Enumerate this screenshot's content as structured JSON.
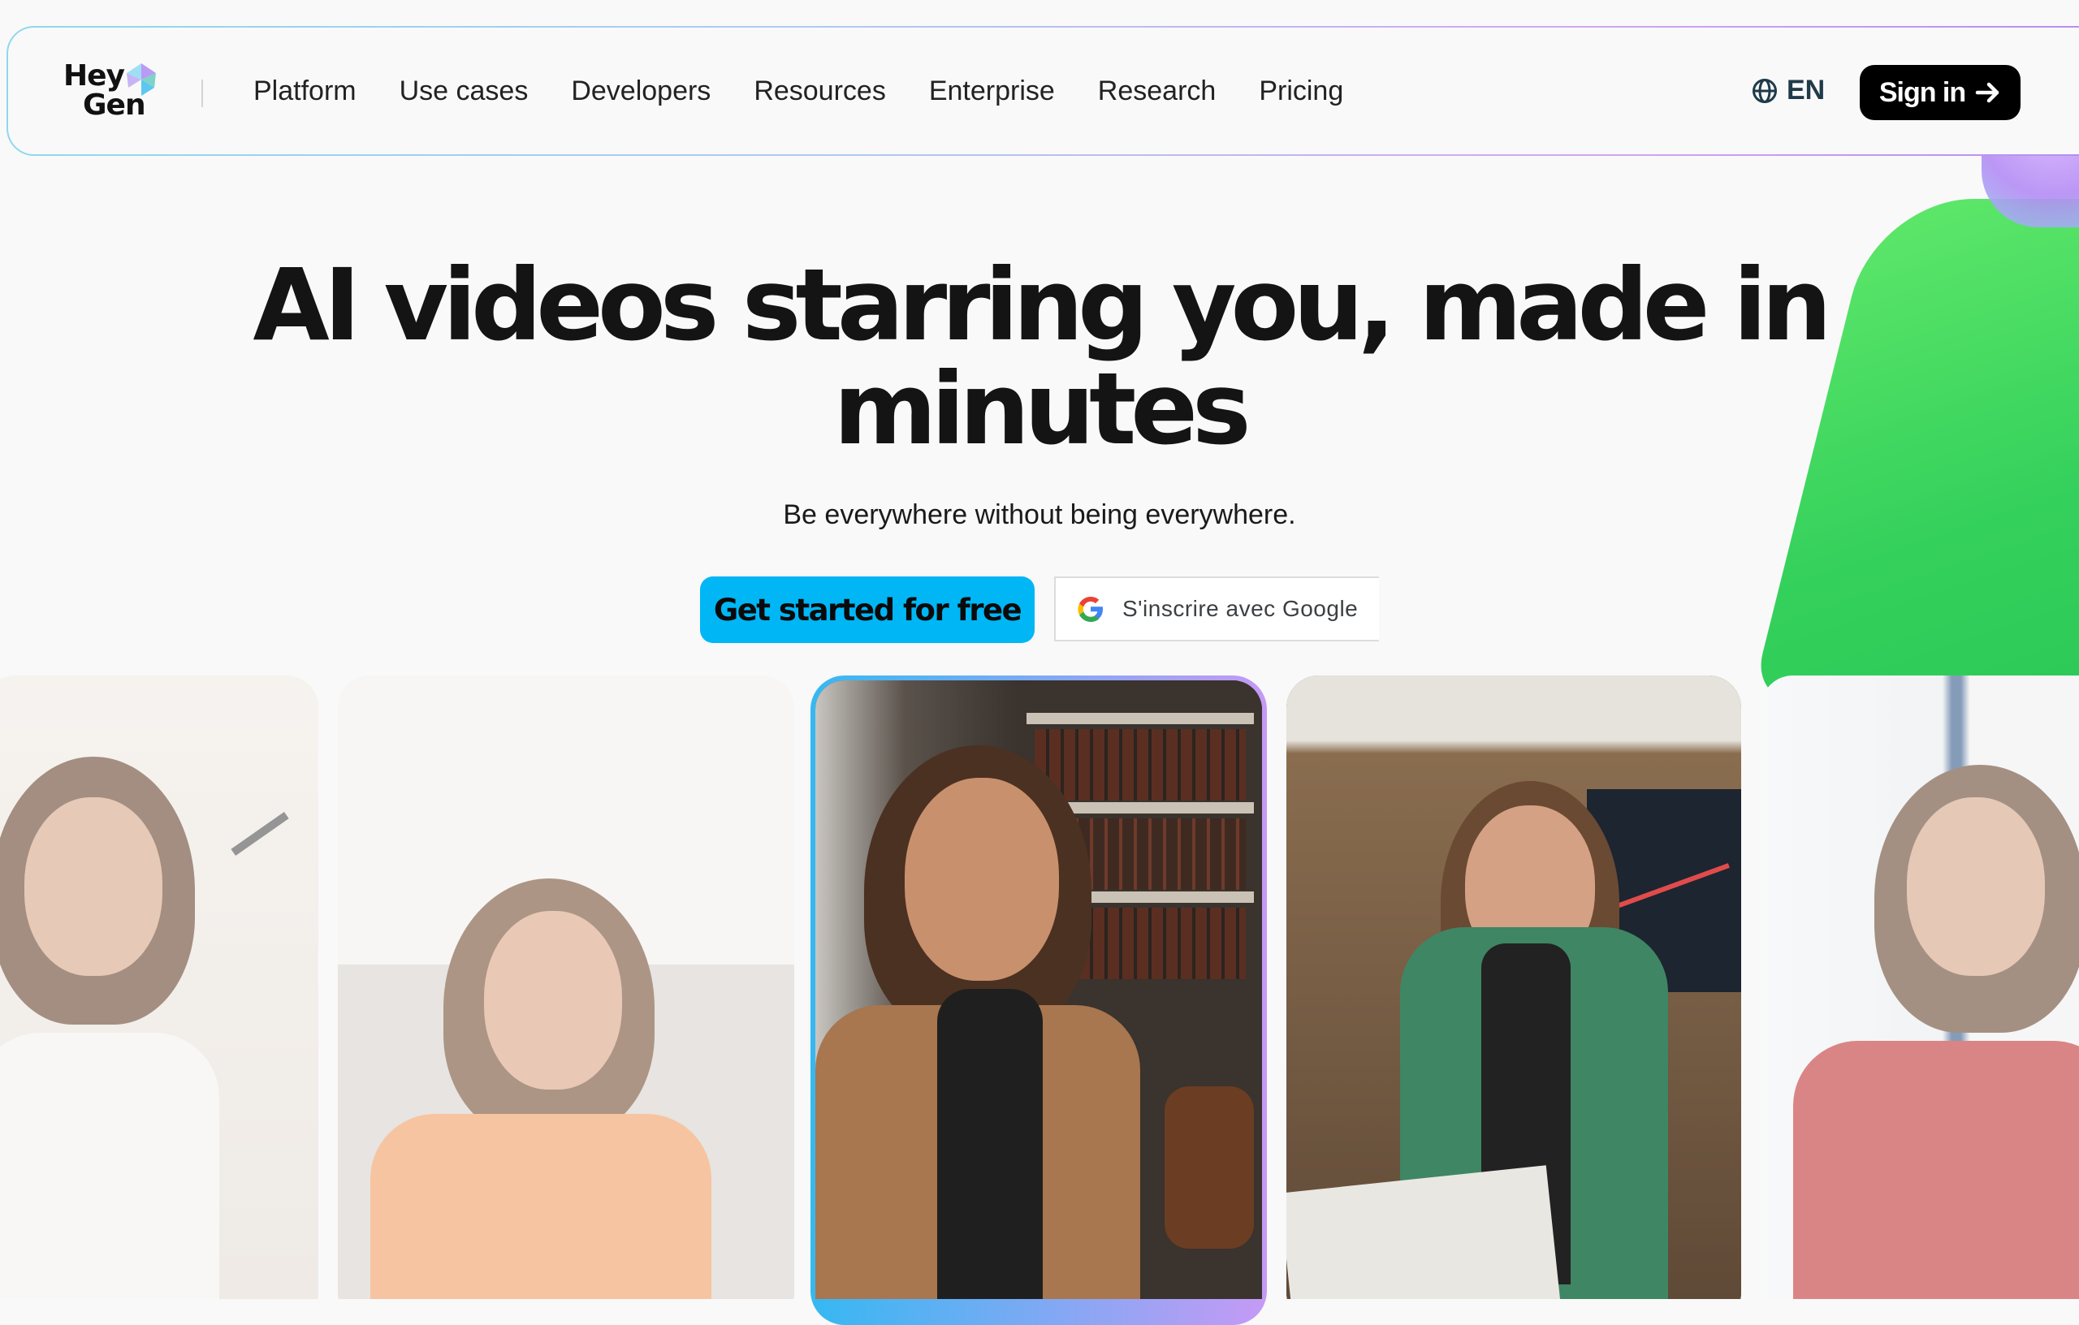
{
  "brand": {
    "logo_line1": "Hey",
    "logo_line2": "Gen",
    "logo_mark_icon": "heygen-gem-icon"
  },
  "nav": {
    "links": [
      "Platform",
      "Use cases",
      "Developers",
      "Resources",
      "Enterprise",
      "Research",
      "Pricing"
    ],
    "language": "EN",
    "language_icon": "globe-icon",
    "signin_label": "Sign in",
    "signin_icon": "arrow-right-icon"
  },
  "hero": {
    "title_line1": "AI videos starring you, made in",
    "title_line2": "minutes",
    "subtitle": "Be everywhere without being everywhere.",
    "cta_primary": "Get started for free",
    "cta_google": "S'inscrire avec Google",
    "google_icon": "google-g-icon"
  },
  "colors": {
    "accent": "#00b6f5",
    "signin_bg": "#000000",
    "nav_border_start": "#8fd8ee",
    "nav_border_end": "#b58cf5",
    "blob_green": "#35d15c",
    "blob_purple": "#b48cf5"
  },
  "video_cards": [
    {
      "scene": "home office with desk lamp",
      "outfit": "white top, earphones",
      "state": "faded"
    },
    {
      "scene": "minimal white room",
      "outfit": "orange shirt",
      "state": "faded"
    },
    {
      "scene": "library with bookshelves",
      "outfit": "camel blazer, black turtleneck",
      "state": "active"
    },
    {
      "scene": "modern office with chart screen",
      "outfit": "green trench coat",
      "state": "normal"
    },
    {
      "scene": "bright apartment with window",
      "outfit": "red blouse",
      "state": "faded"
    }
  ]
}
